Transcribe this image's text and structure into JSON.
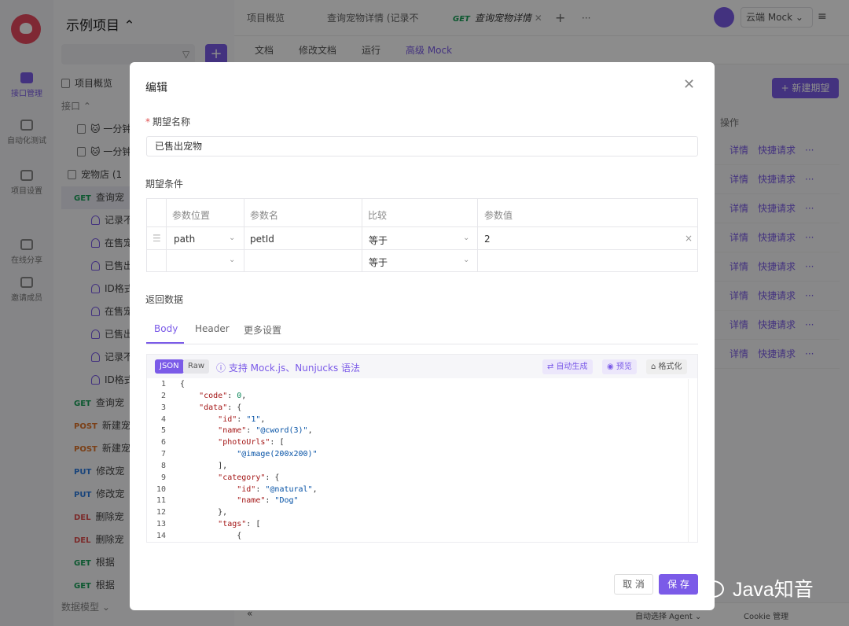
{
  "app": {
    "project_name": "示例项目 ⌃",
    "rail": [
      {
        "label": "接口管理",
        "icon": "api-icon",
        "active": true
      },
      {
        "label": "自动化测试",
        "icon": "test-icon",
        "active": false
      },
      {
        "label": "项目设置",
        "icon": "settings-icon",
        "active": false
      },
      {
        "label": "在线分享",
        "icon": "share-icon",
        "active": false
      },
      {
        "label": "邀请成员",
        "icon": "invite-icon",
        "active": false
      }
    ],
    "tree": {
      "overview": "项目概览",
      "section": "接口 ⌃",
      "items": [
        {
          "method": "",
          "label": "🐱 一分钟",
          "kind": "doc"
        },
        {
          "method": "",
          "label": "🐱 一分钟",
          "kind": "doc"
        },
        {
          "method": "",
          "label": "宠物店 (1",
          "kind": "folder"
        },
        {
          "method": "GET",
          "label": "查询宠",
          "kind": "api",
          "selected": true
        },
        {
          "method": "",
          "label": "记录不",
          "kind": "case"
        },
        {
          "method": "",
          "label": "在售宠",
          "kind": "case"
        },
        {
          "method": "",
          "label": "已售出",
          "kind": "case"
        },
        {
          "method": "",
          "label": "ID格式",
          "kind": "case"
        },
        {
          "method": "",
          "label": "在售宠",
          "kind": "case"
        },
        {
          "method": "",
          "label": "已售出",
          "kind": "case"
        },
        {
          "method": "",
          "label": "记录不",
          "kind": "case"
        },
        {
          "method": "",
          "label": "ID格式",
          "kind": "case"
        },
        {
          "method": "GET",
          "label": "查询宠",
          "kind": "api"
        },
        {
          "method": "POST",
          "label": "新建宠",
          "kind": "api"
        },
        {
          "method": "POST",
          "label": "新建宠",
          "kind": "api"
        },
        {
          "method": "PUT",
          "label": "修改宠",
          "kind": "api"
        },
        {
          "method": "PUT",
          "label": "修改宠",
          "kind": "api"
        },
        {
          "method": "DEL",
          "label": "删除宠",
          "kind": "api"
        },
        {
          "method": "DEL",
          "label": "删除宠",
          "kind": "api"
        },
        {
          "method": "GET",
          "label": "根据",
          "kind": "api"
        },
        {
          "method": "GET",
          "label": "根据",
          "kind": "api"
        }
      ],
      "data_models": "数据模型 ⌄"
    },
    "tabs": [
      {
        "label": "项目概览"
      },
      {
        "label": "查询宠物详情 (记录不"
      },
      {
        "method": "GET",
        "label": "查询宠物详情"
      }
    ],
    "workspace": "云端 Mock",
    "subtabs": [
      "文档",
      "修改文档",
      "运行",
      "高级 Mock"
    ],
    "new_expectation": "+ 新建期望",
    "ops_header": "操作",
    "row_actions": {
      "detail": "详情",
      "quick": "快捷请求",
      "more": "···"
    },
    "bottom": {
      "agent": "自动选择 Agent ⌄",
      "cookie": "Cookie 管理"
    }
  },
  "modal": {
    "title": "编辑",
    "name_label": "期望名称",
    "name_value": "已售出宠物",
    "conditions_label": "期望条件",
    "cond_headers": [
      "参数位置",
      "参数名",
      "比较",
      "参数值"
    ],
    "cond_rows": [
      {
        "position": "path",
        "name": "petId",
        "compare": "等于",
        "value": "2"
      },
      {
        "position": "",
        "name": "",
        "compare": "等于",
        "value": ""
      }
    ],
    "return_label": "返回数据",
    "body_tabs": [
      "Body",
      "Header",
      "更多设置"
    ],
    "json_pill": "JSON",
    "raw_pill": "Raw",
    "mock_tip": "ⓘ 支持 Mock.js、Nunjucks 语法",
    "auto_gen": "⇄ 自动生成",
    "preview": "◉ 预览",
    "format": "⌂ 格式化",
    "code_lines": [
      "{",
      "    \"code\": 0,",
      "    \"data\": {",
      "        \"id\": \"1\",",
      "        \"name\": \"@cword(3)\",",
      "        \"photoUrls\": [",
      "            \"@image(200x200)\"",
      "        ],",
      "        \"category\": {",
      "            \"id\": \"@natural\",",
      "            \"name\": \"Dog\"",
      "        },",
      "        \"tags\": [",
      "            {"
    ],
    "cancel": "取 消",
    "save": "保 存"
  },
  "watermark": "Java知音"
}
